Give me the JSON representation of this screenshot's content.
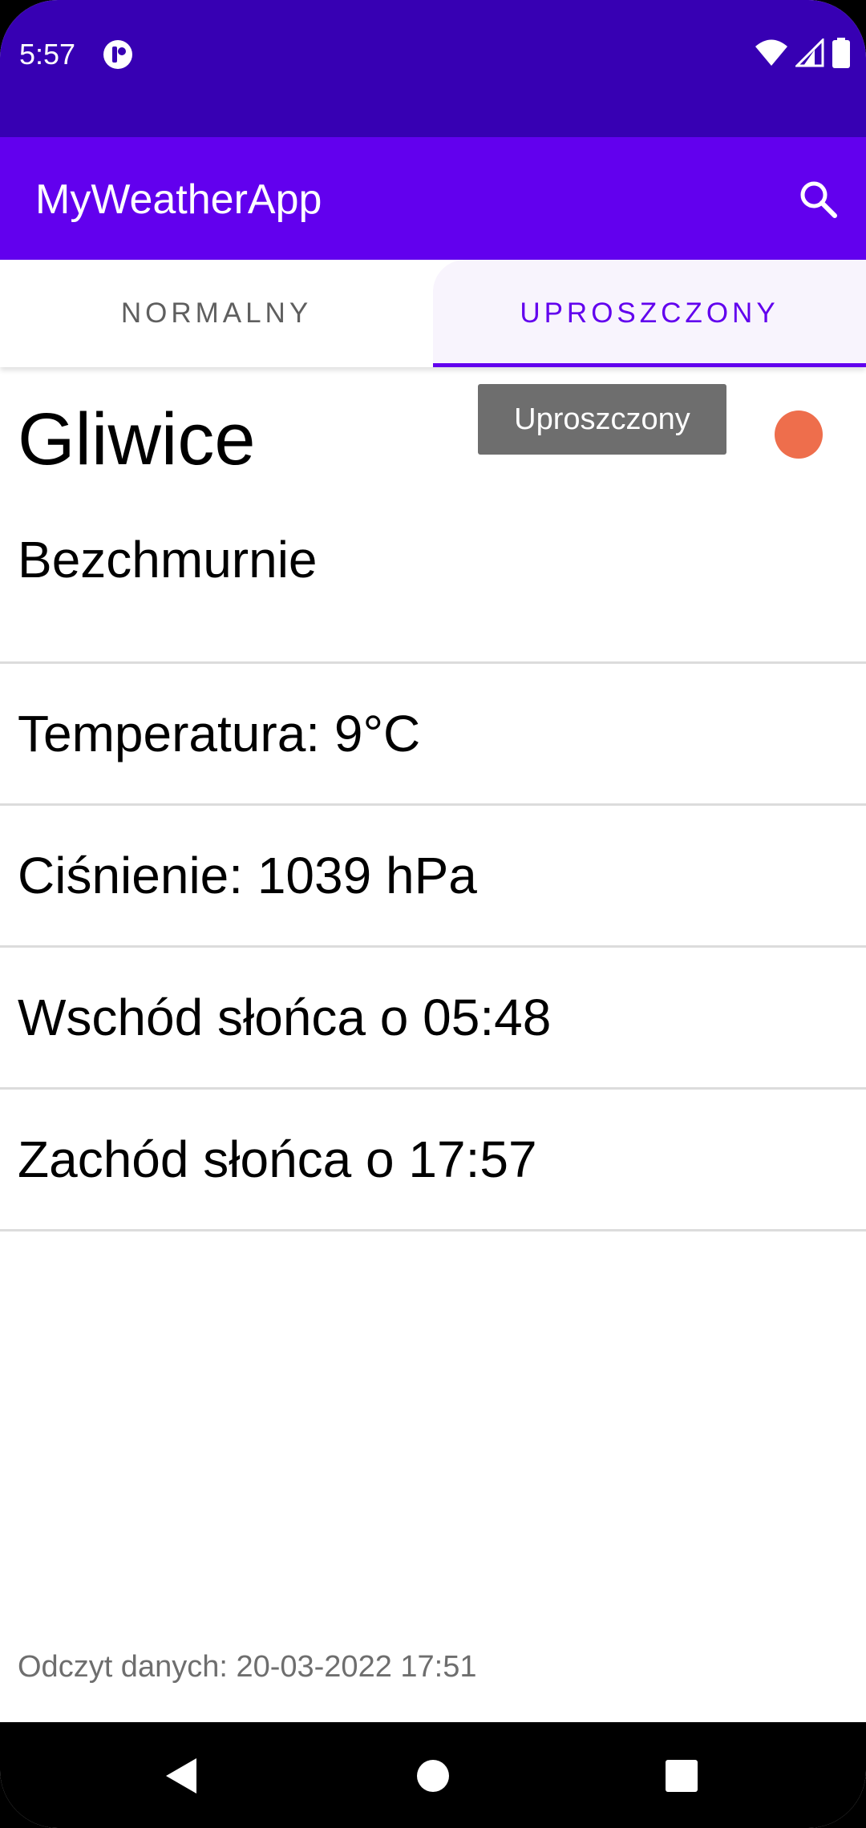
{
  "status_bar": {
    "time": "5:57",
    "bg_color": "#3700b3",
    "icons": [
      "app-notification-icon",
      "wifi-icon",
      "signal-icon",
      "battery-icon"
    ]
  },
  "app_bar": {
    "title": "MyWeatherApp",
    "bg_color": "#6200ee",
    "search_icon": "search-icon"
  },
  "tabs": [
    {
      "label": "NORMALNY",
      "selected": false
    },
    {
      "label": "UPROSZCZONY",
      "selected": true
    }
  ],
  "weather": {
    "city": "Gliwice",
    "condition": "Bezchmurnie",
    "tooltip": "Uproszczony",
    "status_dot_color": "#ee6e4c",
    "details": [
      "Temperatura: 9°C",
      "Ciśnienie: 1039 hPa",
      "Wschód słońca o 05:48",
      "Zachód słońca o 17:57"
    ],
    "timestamp": "Odczyt danych: 20-03-2022 17:51"
  },
  "nav_bar": {
    "buttons": [
      "back-icon",
      "home-icon",
      "recents-icon"
    ]
  }
}
